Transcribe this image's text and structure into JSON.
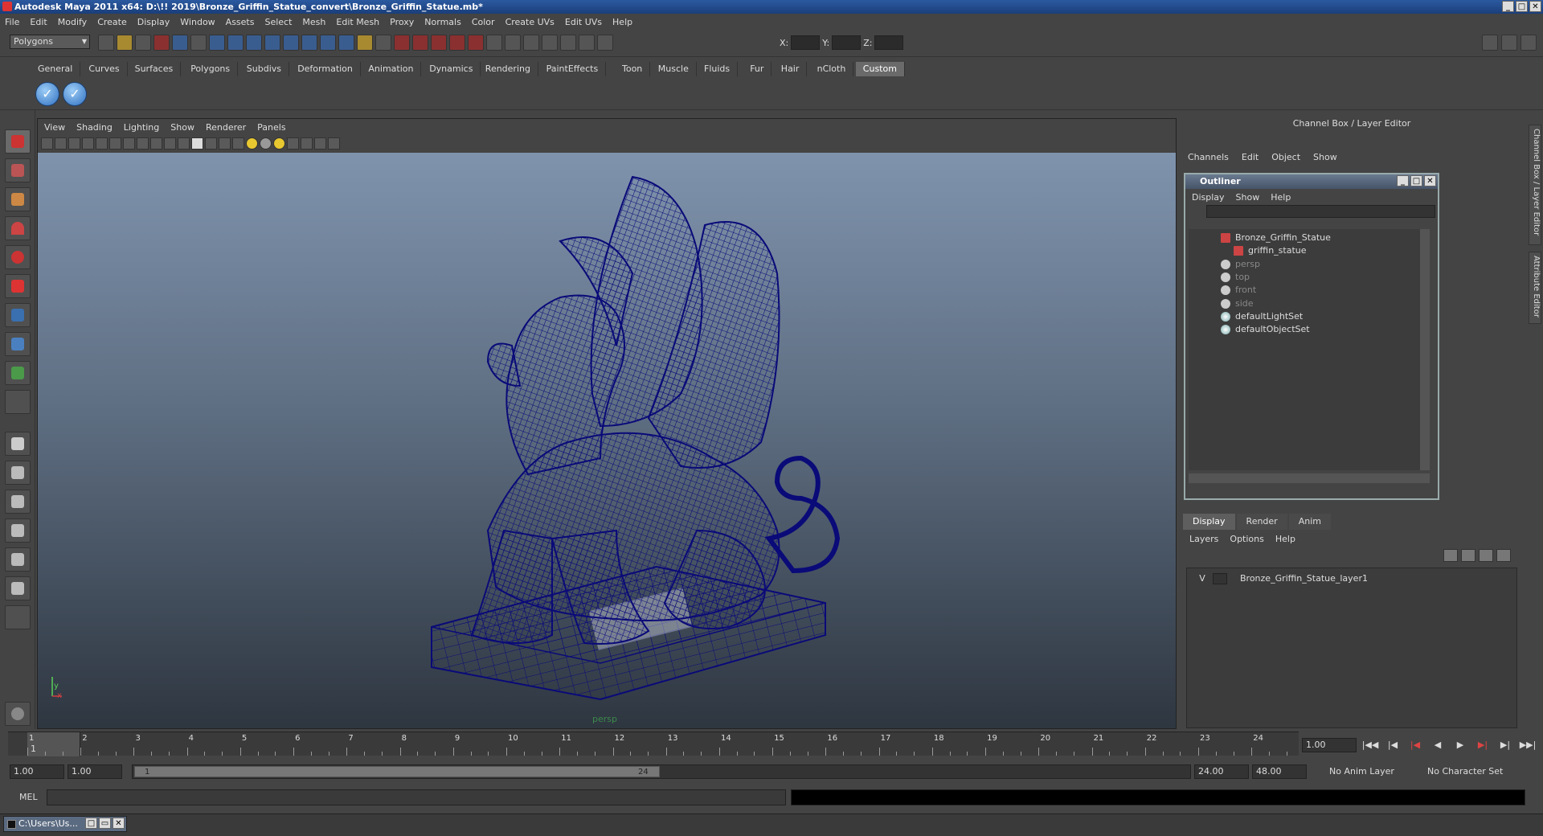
{
  "window": {
    "title": "Autodesk Maya 2011 x64: D:\\!! 2019\\Bronze_Griffin_Statue_convert\\Bronze_Griffin_Statue.mb*"
  },
  "menubar": [
    "File",
    "Edit",
    "Modify",
    "Create",
    "Display",
    "Window",
    "Assets",
    "Select",
    "Mesh",
    "Edit Mesh",
    "Proxy",
    "Normals",
    "Color",
    "Create UVs",
    "Edit UVs",
    "Help"
  ],
  "toolbar": {
    "mode": "Polygons",
    "x_label": "X:",
    "y_label": "Y:",
    "z_label": "Z:"
  },
  "shelf_tabs": [
    "General",
    "Curves",
    "Surfaces",
    "Polygons",
    "Subdivs",
    "Deformation",
    "Animation",
    "Dynamics",
    "Rendering",
    "PaintEffects",
    "Toon",
    "Muscle",
    "Fluids",
    "Fur",
    "Hair",
    "nCloth",
    "Custom"
  ],
  "active_shelf_tab": "Custom",
  "viewport": {
    "menus": [
      "View",
      "Shading",
      "Lighting",
      "Show",
      "Renderer",
      "Panels"
    ],
    "camera": "persp",
    "axis_x": "x",
    "axis_y": "y",
    "wire_color": "#0a0a78"
  },
  "channel_box": {
    "title": "Channel Box / Layer Editor",
    "menus": [
      "Channels",
      "Edit",
      "Object",
      "Show"
    ]
  },
  "outliner": {
    "title": "Outliner",
    "menus": [
      "Display",
      "Show",
      "Help"
    ],
    "items": [
      {
        "label": "Bronze_Griffin_Statue",
        "dim": false,
        "type": "mesh"
      },
      {
        "label": "griffin_statue",
        "dim": false,
        "type": "mesh"
      },
      {
        "label": "persp",
        "dim": true,
        "type": "cam"
      },
      {
        "label": "top",
        "dim": true,
        "type": "cam"
      },
      {
        "label": "front",
        "dim": true,
        "type": "cam"
      },
      {
        "label": "side",
        "dim": true,
        "type": "cam"
      },
      {
        "label": "defaultLightSet",
        "dim": false,
        "type": "set"
      },
      {
        "label": "defaultObjectSet",
        "dim": false,
        "type": "set"
      }
    ]
  },
  "layer_editor": {
    "tabs": [
      "Display",
      "Render",
      "Anim"
    ],
    "active_tab": "Display",
    "menus": [
      "Layers",
      "Options",
      "Help"
    ],
    "layers": [
      {
        "visible": "V",
        "name": "Bronze_Griffin_Statue_layer1"
      }
    ]
  },
  "side_tabs": [
    "Channel Box / Layer Editor",
    "Attribute Editor"
  ],
  "timeline": {
    "ticks": [
      "1",
      "2",
      "3",
      "4",
      "5",
      "6",
      "7",
      "8",
      "9",
      "10",
      "11",
      "12",
      "13",
      "14",
      "15",
      "16",
      "17",
      "18",
      "19",
      "20",
      "21",
      "22",
      "23",
      "24"
    ],
    "current": "1",
    "current_field": "1.00"
  },
  "range": {
    "start": "1.00",
    "start2": "1.00",
    "slider_start": "1",
    "slider_end": "24",
    "end": "24.00",
    "end2": "48.00",
    "anim_layer": "No Anim Layer",
    "char_set": "No Character Set"
  },
  "mel": {
    "label": "MEL"
  },
  "taskbar": {
    "item": "C:\\Users\\Us..."
  }
}
